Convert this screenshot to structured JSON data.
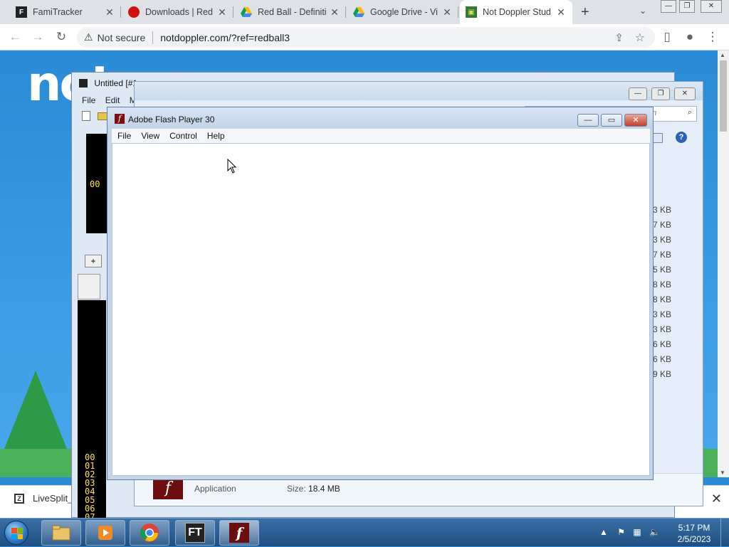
{
  "browser": {
    "tabs": [
      {
        "title": "FamiTracker",
        "icon": "famitracker-icon"
      },
      {
        "title": "Downloads | Red",
        "icon": "red-ball-icon"
      },
      {
        "title": "Red Ball - Definiti",
        "icon": "google-drive-icon"
      },
      {
        "title": "Google Drive - Vi",
        "icon": "google-drive-icon"
      },
      {
        "title": "Not Doppler Stud",
        "icon": "notdoppler-icon"
      }
    ],
    "security_label": "Not secure",
    "url": "notdoppler.com/?ref=redball3"
  },
  "page": {
    "logo_text": "not"
  },
  "downloads": {
    "item_label": "LiveSplit_"
  },
  "famitracker": {
    "title": "Untitled [#1",
    "menu": [
      "File",
      "Edit",
      "M"
    ],
    "pattern_value": "00",
    "add_label": "+",
    "row_numbers": [
      "00",
      "01",
      "02",
      "03",
      "04",
      "05",
      "06",
      "07"
    ]
  },
  "explorer": {
    "search_placeholder": "ction",
    "sizes": [
      "3 KB",
      "7 KB",
      "3 KB",
      "7 KB",
      "5 KB",
      "8 KB",
      "8 KB",
      "3 KB",
      "3 KB",
      "6 KB",
      "6 KB",
      "9 KB"
    ],
    "detail": {
      "type": "Application",
      "size_label": "Size:",
      "size_value": "18.4 MB"
    }
  },
  "flash": {
    "title": "Adobe Flash Player 30",
    "menu": [
      "File",
      "View",
      "Control",
      "Help"
    ]
  },
  "taskbar": {
    "apps": [
      {
        "name": "explorer-taskbar-icon"
      },
      {
        "name": "media-player-taskbar-icon"
      },
      {
        "name": "chrome-taskbar-icon"
      },
      {
        "name": "famitracker-taskbar-icon",
        "label": "FT"
      },
      {
        "name": "flash-taskbar-icon",
        "label": "f"
      }
    ],
    "time": "5:17 PM",
    "date": "2/5/2023"
  }
}
